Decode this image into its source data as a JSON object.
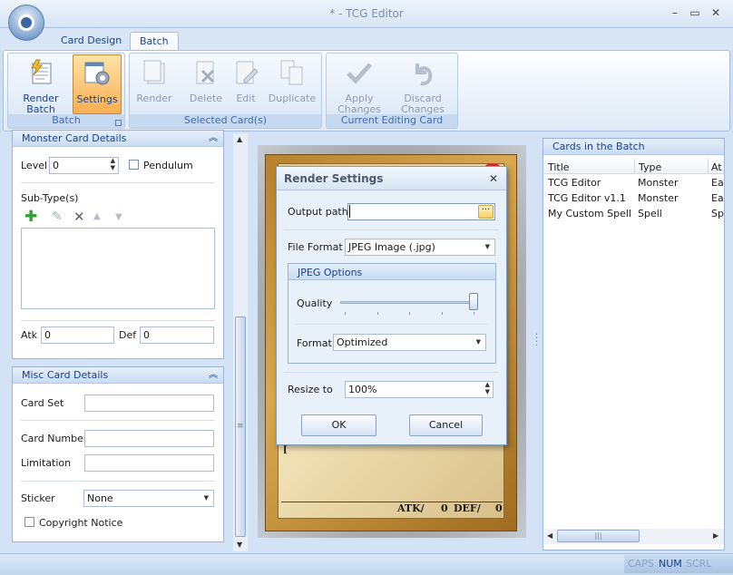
{
  "window": {
    "title": "* - TCG Editor",
    "min": "–",
    "max": "▭",
    "close": "✕"
  },
  "tabs": [
    {
      "label": "Card Design"
    },
    {
      "label": "Batch"
    }
  ],
  "ribbon": {
    "groups": [
      {
        "caption": "Batch",
        "buttons": [
          {
            "label": "Render Batch"
          },
          {
            "label": "Settings"
          }
        ]
      },
      {
        "caption": "Selected Card(s)",
        "buttons": [
          {
            "label": "Render"
          },
          {
            "label": "Delete"
          },
          {
            "label": "Edit"
          },
          {
            "label": "Duplicate"
          }
        ]
      },
      {
        "caption": "Current Editing Card",
        "buttons": [
          {
            "label": "Apply Changes"
          },
          {
            "label": "Discard Changes"
          }
        ]
      }
    ]
  },
  "monster_panel": {
    "title": "Monster Card Details",
    "level_label": "Level",
    "level_value": "0",
    "pendulum_label": "Pendulum",
    "subtype_label": "Sub-Type(s)",
    "atk_label": "Atk",
    "atk_value": "0",
    "def_label": "Def",
    "def_value": "0"
  },
  "misc_panel": {
    "title": "Misc Card Details",
    "card_set_label": "Card Set",
    "card_number_label": "Card Number",
    "limitation_label": "Limitation",
    "sticker_label": "Sticker",
    "sticker_value": "None",
    "copyright_label": "Copyright Notice"
  },
  "card_preview": {
    "atk_text": "ATK/",
    "atk_value": "0",
    "def_text": "DEF/",
    "def_value": "0",
    "bracket": "["
  },
  "dialog": {
    "title": "Render Settings",
    "output_label": "Output path",
    "output_value": "",
    "format_label": "File Format",
    "format_value": "JPEG Image (.jpg)",
    "jpeg_group": "JPEG Options",
    "quality_label": "Quality",
    "quality_level": 1.0,
    "jpeg_format_label": "Format",
    "jpeg_format_value": "Optimized",
    "resize_label": "Resize to",
    "resize_value": "100%",
    "ok": "OK",
    "cancel": "Cancel"
  },
  "batch_panel": {
    "title": "Cards in the Batch",
    "columns": [
      "Title",
      "Type",
      "At"
    ],
    "rows": [
      [
        "TCG Editor",
        "Monster",
        "Ea"
      ],
      [
        "TCG Editor v1.1",
        "Monster",
        "Ea"
      ],
      [
        "My Custom Spell",
        "Spell",
        "Sp"
      ]
    ]
  },
  "status": {
    "caps": "CAPS",
    "num": "NUM",
    "scrl": "SCRL"
  },
  "icons": [
    "app-orb-icon",
    "render-batch-icon",
    "settings-icon",
    "render-icon",
    "delete-icon",
    "edit-icon",
    "duplicate-icon",
    "apply-icon",
    "discard-icon",
    "add-icon",
    "pencil-icon",
    "remove-icon",
    "move-up-icon",
    "move-down-icon",
    "ellipsis-icon",
    "close-icon"
  ]
}
